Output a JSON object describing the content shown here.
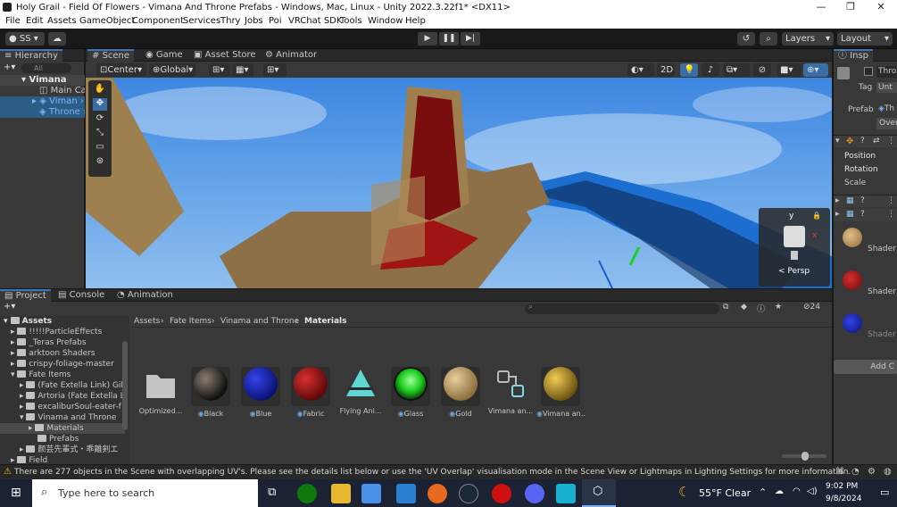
{
  "window": {
    "title": "Holy Grail - Field Of Flowers - Vimana And Throne Prefabs - Windows, Mac, Linux - Unity 2022.3.22f1* <DX11>"
  },
  "menu": [
    "File",
    "Edit",
    "Assets",
    "GameObject",
    "Component",
    "Services",
    "Thry",
    "Jobs",
    "Poi",
    "VRChat SDK",
    "Tools",
    "Window",
    "Help"
  ],
  "toolbar": {
    "account": "SS",
    "layers": "Layers",
    "layout": "Layout"
  },
  "hierarchy": {
    "tab": "Hierarchy",
    "search_placeholder": "All",
    "items": [
      {
        "label": "Vimana"
      },
      {
        "label": "Main Car"
      },
      {
        "label": "Viman"
      },
      {
        "label": "Throne"
      }
    ]
  },
  "scene": {
    "tabs": [
      "Scene",
      "Game",
      "Asset Store",
      "Animator"
    ],
    "pivot": "Center",
    "space": "Global",
    "mode_2d": "2D",
    "gizmo": {
      "y": "y",
      "x": "x",
      "persp": "< Persp"
    }
  },
  "inspector": {
    "tab": "Insp",
    "name_field": "Thro",
    "tag_label": "Tag",
    "tag_value": "Unt",
    "prefab_label": "Prefab",
    "prefab_value": "Th",
    "overrides": "Over",
    "transform": {
      "position": "Position",
      "rotation": "Rotation",
      "scale": "Scale"
    },
    "shader_labels": [
      "Shader",
      "Shader",
      "Shader"
    ],
    "add_component": "Add C"
  },
  "project": {
    "tabs": [
      "Project",
      "Console",
      "Animation"
    ],
    "slider_count": "24",
    "breadcrumb": [
      "Assets",
      "Fate Items",
      "Vinama and Throne",
      "Materials"
    ],
    "tree": [
      {
        "label": "Assets",
        "depth": 0
      },
      {
        "label": "!!!!!ParticleEffects",
        "depth": 1
      },
      {
        "label": "_Teras Prefabs",
        "depth": 1
      },
      {
        "label": "arktoon Shaders",
        "depth": 1
      },
      {
        "label": "crispy-foliage-master",
        "depth": 1
      },
      {
        "label": "Fate Items",
        "depth": 1
      },
      {
        "label": "(Fate Extella Link) Gil",
        "depth": 2
      },
      {
        "label": "Artoria (Fate Extella L",
        "depth": 2
      },
      {
        "label": "excaliburSoul-eater-f",
        "depth": 2
      },
      {
        "label": "Vinama and Throne",
        "depth": 2
      },
      {
        "label": "Materials",
        "depth": 3
      },
      {
        "label": "Prefabs",
        "depth": 3
      },
      {
        "label": "颜芸先輩式・乖離剣エ",
        "depth": 2
      },
      {
        "label": "Field",
        "depth": 1
      }
    ],
    "assets": [
      {
        "label": "Optimized...",
        "kind": "folder"
      },
      {
        "label": "Black",
        "color": "#1a1a1a"
      },
      {
        "label": "Blue",
        "color": "#1022a8"
      },
      {
        "label": "Fabric",
        "color": "#8b0d0d"
      },
      {
        "label": "Flying Ani...",
        "kind": "anim"
      },
      {
        "label": "Glass",
        "color": "#1dcc1d"
      },
      {
        "label": "Gold",
        "color": "#b9955a"
      },
      {
        "label": "Vimana an...",
        "kind": "prefab"
      },
      {
        "label": "Vimana an...",
        "color": "#b88a1e"
      }
    ]
  },
  "status": {
    "message": "There are 277 objects in the Scene with overlapping UV's. Please see the details list below or use the 'UV Overlap' visualisation mode in the Scene View or Lightmaps in Lighting Settings for more information."
  },
  "taskbar": {
    "search_placeholder": "Type here to search",
    "weather": "55°F  Clear",
    "time": "9:02 PM",
    "date": "9/8/2024"
  }
}
